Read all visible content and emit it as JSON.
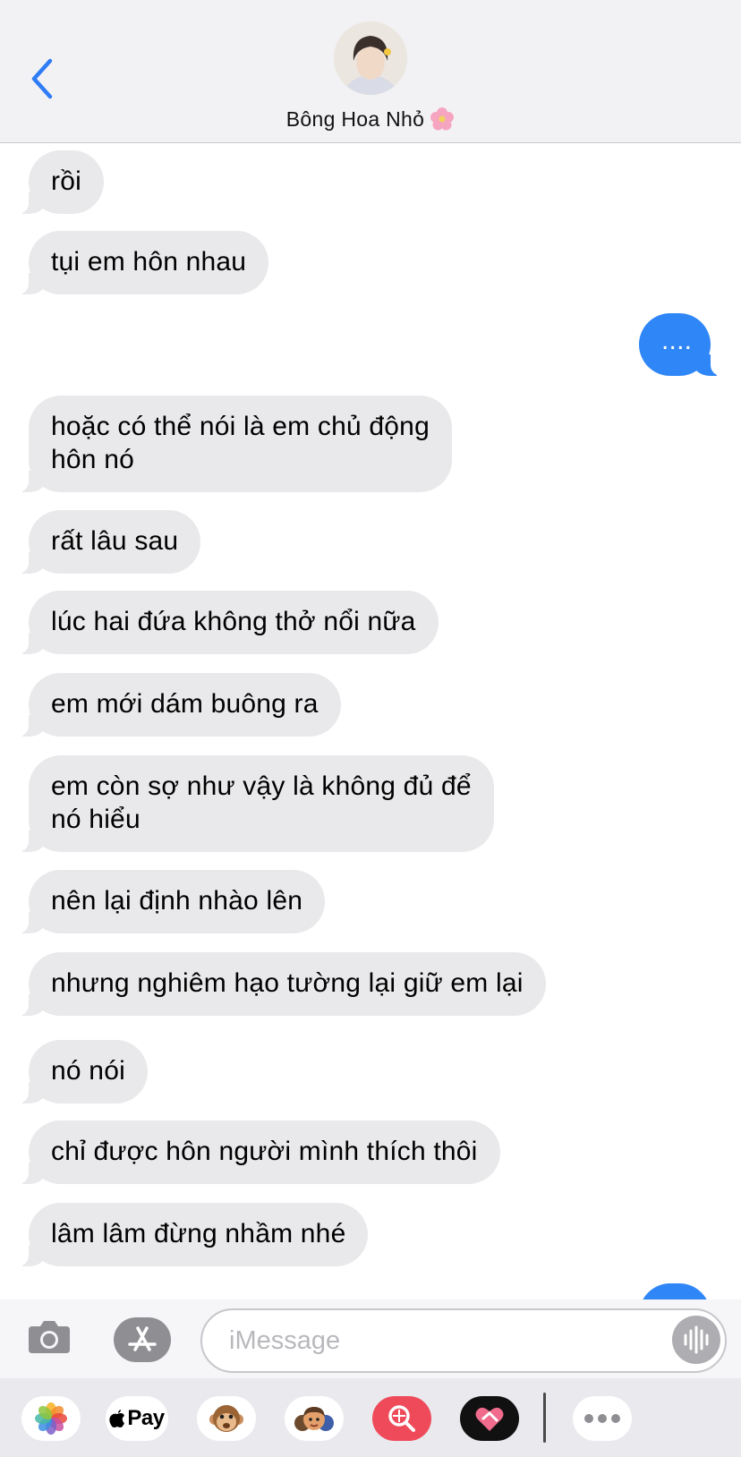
{
  "header": {
    "contact_name": "Bông Hoa Nhỏ",
    "back_icon": "chevron-left-icon",
    "flower_icon": "cherry-blossom-icon"
  },
  "messages": [
    {
      "direction": "in",
      "text": "rồi"
    },
    {
      "direction": "in",
      "text": "tụi em hôn nhau"
    },
    {
      "direction": "out",
      "text": "...."
    },
    {
      "direction": "in",
      "lines": [
        "hoặc có thể nói là em chủ động",
        "hôn nó"
      ]
    },
    {
      "direction": "in",
      "text": "rất lâu sau"
    },
    {
      "direction": "in",
      "text": "lúc hai đứa không thở nổi nữa"
    },
    {
      "direction": "in",
      "text": "em mới dám buông ra"
    },
    {
      "direction": "in",
      "lines": [
        "em còn sợ như vậy là không đủ để",
        "nó hiểu"
      ]
    },
    {
      "direction": "in",
      "text": "nên lại định nhào lên"
    },
    {
      "direction": "in",
      "text": "nhưng nghiêm hạo tường lại giữ em lại"
    },
    {
      "direction": "in",
      "text": "nó nói"
    },
    {
      "direction": "in",
      "text": "chỉ được hôn người mình thích thôi"
    },
    {
      "direction": "in",
      "text": "lâm lâm đừng nhầm nhé"
    }
  ],
  "input": {
    "placeholder": "iMessage",
    "camera_icon": "camera-icon",
    "appstore_icon": "app-store-icon",
    "audio_icon": "audio-waveform-icon"
  },
  "app_drawer": {
    "items": [
      "photos-icon",
      "apple-pay-icon",
      "animoji-icon",
      "memoji-stickers-icon",
      "image-search-icon",
      "digital-touch-icon",
      "more-icon"
    ],
    "apple_pay_label": "Pay"
  },
  "colors": {
    "incoming_bubble": "#e9e9eb",
    "outgoing_bubble": "#2f86f6",
    "accent": "#2f7cf6"
  }
}
